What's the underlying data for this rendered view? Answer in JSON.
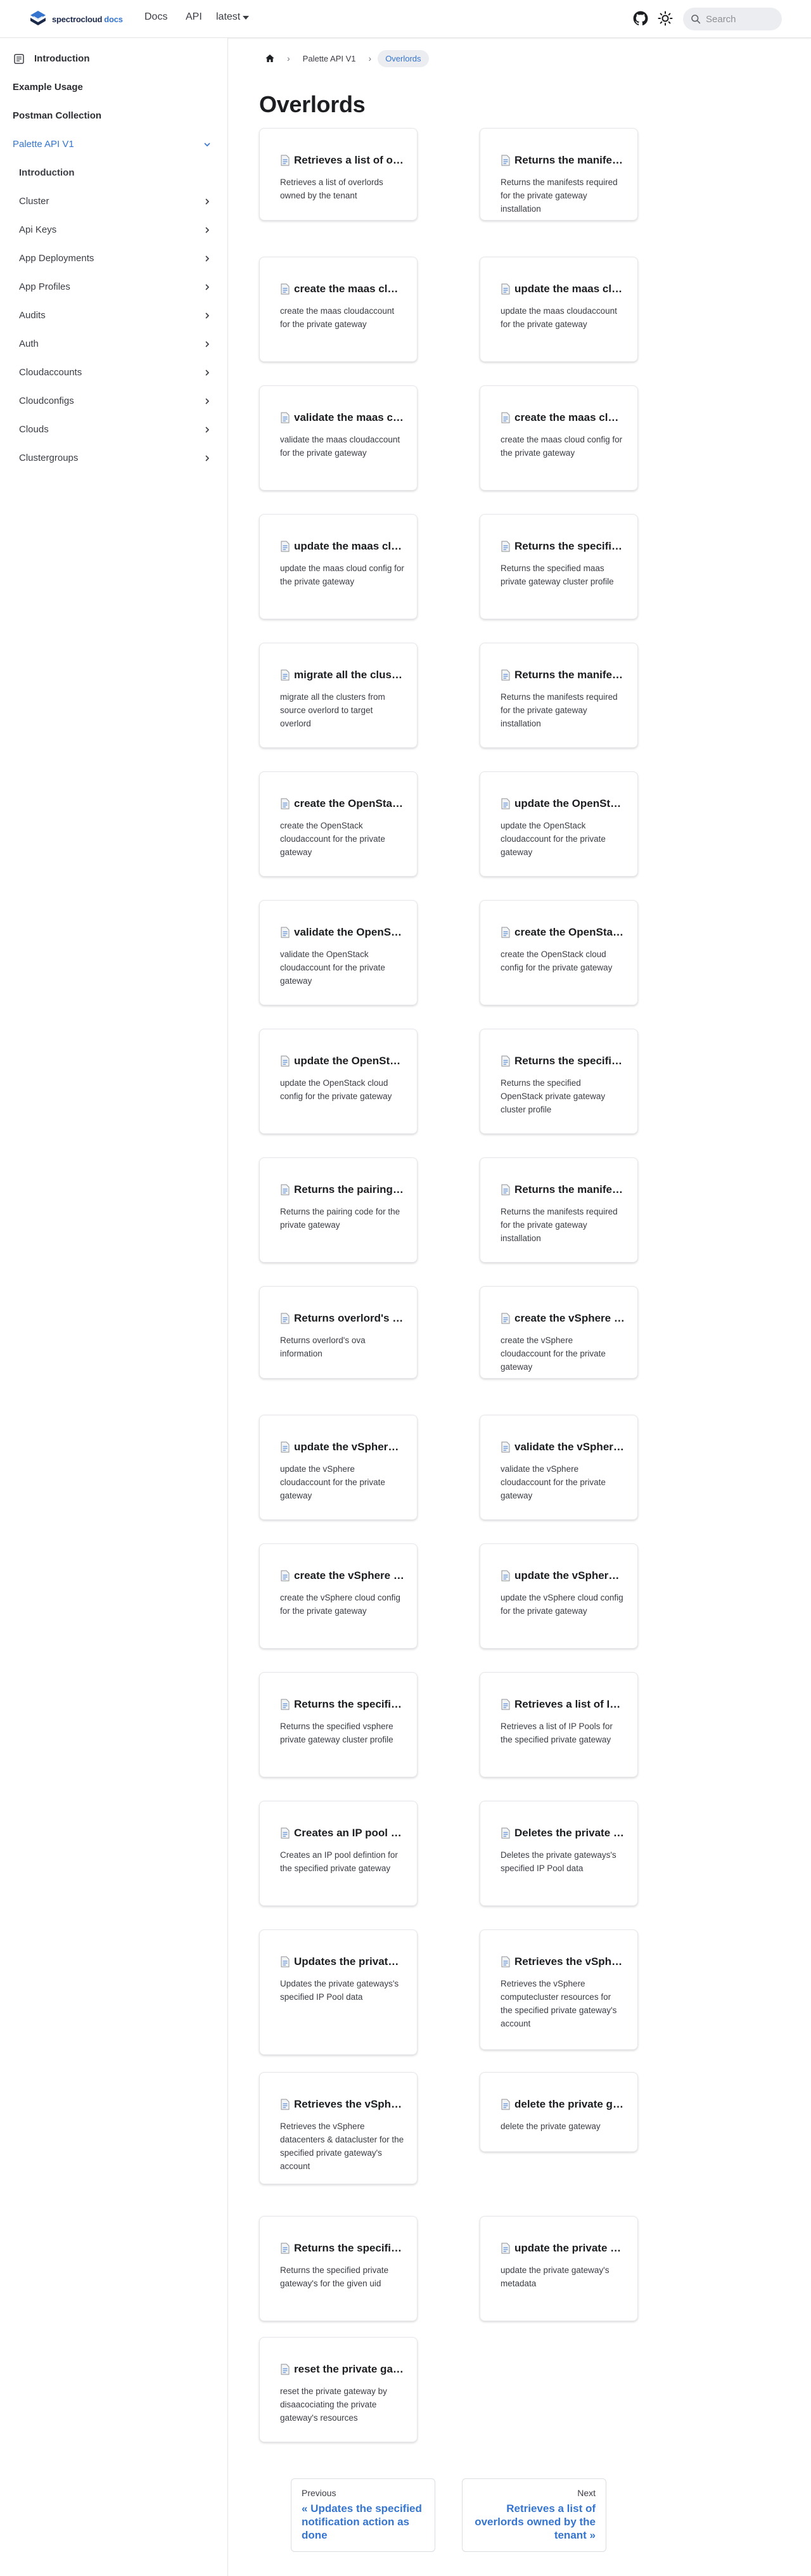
{
  "navbar": {
    "brand_name": "spectrocloud",
    "brand_docs": "docs",
    "links": [
      "Docs",
      "API"
    ],
    "version": "latest",
    "search_placeholder": "Search",
    "icons": [
      "github-icon",
      "theme-toggle-icon",
      "search-icon"
    ]
  },
  "sidebar": {
    "items": [
      {
        "label": "Introduction",
        "kind": "top-icon"
      },
      {
        "label": "Example Usage",
        "kind": "top"
      },
      {
        "label": "Postman Collection",
        "kind": "top"
      },
      {
        "label": "Palette API V1",
        "kind": "category-open"
      },
      {
        "label": "Introduction",
        "kind": "sub-bold"
      },
      {
        "label": "Cluster",
        "kind": "sub-collapsed"
      },
      {
        "label": "Api Keys",
        "kind": "sub-collapsed"
      },
      {
        "label": "App Deployments",
        "kind": "sub-collapsed"
      },
      {
        "label": "App Profiles",
        "kind": "sub-collapsed"
      },
      {
        "label": "Audits",
        "kind": "sub-collapsed"
      },
      {
        "label": "Auth",
        "kind": "sub-collapsed"
      },
      {
        "label": "Cloudaccounts",
        "kind": "sub-collapsed"
      },
      {
        "label": "Cloudconfigs",
        "kind": "sub-collapsed"
      },
      {
        "label": "Clouds",
        "kind": "sub-collapsed"
      },
      {
        "label": "Clustergroups",
        "kind": "sub-collapsed"
      }
    ]
  },
  "breadcrumbs": {
    "items": [
      "Palette API V1"
    ],
    "current": "Overlords"
  },
  "page_title": "Overlords",
  "cards": [
    {
      "title": "Retrieves a list of overlords owned by the tenant",
      "desc": "Retrieves a list of overlords owned by the tenant"
    },
    {
      "title": "Returns the manifests required for the private gateway installation",
      "desc": "Returns the manifests required for the private gateway installation"
    },
    {
      "title": "create the maas cloudaccount for the private gateway",
      "desc": "create the maas cloudaccount for the private gateway"
    },
    {
      "title": "update the maas cloudaccount for the private gateway",
      "desc": "update the maas cloudaccount for the private gateway"
    },
    {
      "title": "validate the maas cloudaccount for the private gateway",
      "desc": "validate the maas cloudaccount for the private gateway"
    },
    {
      "title": "create the maas cloud config for the private gateway",
      "desc": "create the maas cloud config for the private gateway"
    },
    {
      "title": "update the maas cloud config for the private gateway",
      "desc": "update the maas cloud config for the private gateway"
    },
    {
      "title": "Returns the specified maas private gateway cluster profile",
      "desc": "Returns the specified maas private gateway cluster profile"
    },
    {
      "title": "migrate all the clusters from source overlord to target overlord",
      "desc": "migrate all the clusters from source overlord to target overlord"
    },
    {
      "title": "Returns the manifests required for the private gateway installation",
      "desc": "Returns the manifests required for the private gateway installation"
    },
    {
      "title": "create the OpenStack cloudaccount for the private gateway",
      "desc": "create the OpenStack cloudaccount for the private gateway"
    },
    {
      "title": "update the OpenStack cloudaccount for the private gateway",
      "desc": "update the OpenStack cloudaccount for the private gateway"
    },
    {
      "title": "validate the OpenStack cloudaccount for the private gateway",
      "desc": "validate the OpenStack cloudaccount for the private gateway"
    },
    {
      "title": "create the OpenStack cloud config for the private gateway",
      "desc": "create the OpenStack cloud config for the private gateway"
    },
    {
      "title": "update the OpenStack cloud config for the private gateway",
      "desc": "update the OpenStack cloud config for the private gateway"
    },
    {
      "title": "Returns the specified OpenStack private gateway cluster profile",
      "desc": "Returns the specified OpenStack private gateway cluster profile"
    },
    {
      "title": "Returns the pairing code for the private gateway",
      "desc": "Returns the pairing code for the private gateway"
    },
    {
      "title": "Returns the manifests required for the private gateway installation",
      "desc": "Returns the manifests required for the private gateway installation"
    },
    {
      "title": "Returns overlord's ova information",
      "desc": "Returns overlord's ova information"
    },
    {
      "title": "create the vSphere cloudaccount for the private gateway",
      "desc": "create the vSphere cloudaccount for the private gateway"
    },
    {
      "title": "update the vSphere cloudaccount for the private gateway",
      "desc": "update the vSphere cloudaccount for the private gateway"
    },
    {
      "title": "validate the vSphere cloudaccount for the private gateway",
      "desc": "validate the vSphere cloudaccount for the private gateway"
    },
    {
      "title": "create the vSphere cloud config for the private gateway",
      "desc": "create the vSphere cloud config for the private gateway"
    },
    {
      "title": "update the vSphere cloud config for the private gateway",
      "desc": "update the vSphere cloud config for the private gateway"
    },
    {
      "title": "Returns the specified vsphere private gateway cluster profile",
      "desc": "Returns the specified vsphere private gateway cluster profile"
    },
    {
      "title": "Retrieves a list of IP Pools for the specified private gateway",
      "desc": "Retrieves a list of IP Pools for the specified private gateway"
    },
    {
      "title": "Creates an IP pool defintion for the specified private gateway",
      "desc": "Creates an IP pool defintion for the specified private gateway"
    },
    {
      "title": "Deletes the private gateways's specified IP Pool data",
      "desc": "Deletes the private gateways's specified IP Pool data"
    },
    {
      "title": "Updates the private gateways's specified IP Pool data",
      "desc": "Updates the private gateways's specified IP Pool data"
    },
    {
      "title": "Retrieves the vSphere computecluster resources for the specified private gateway's account",
      "desc": "Retrieves the vSphere computecluster resources for the specified private gateway's account"
    },
    {
      "title": "Retrieves the vSphere datacenters & datacluster for the specified private gateway's account",
      "desc": "Retrieves the vSphere datacenters & datacluster for the specified private gateway's account"
    },
    {
      "title": "delete the private gateway",
      "desc": "delete the private gateway"
    },
    {
      "title": "Returns the specified private gateway's for the given uid",
      "desc": "Returns the specified private gateway's for the given uid"
    },
    {
      "title": "update the private gateway's metadata",
      "desc": "update the private gateway's metadata"
    },
    {
      "title": "reset the private gateway by disaacociating the private gateway's resources",
      "desc": "reset the private gateway by disaacociating the private gateway's resources"
    }
  ],
  "pagination": {
    "prev_label": "Previous",
    "prev_title": "« Updates the specified notification action as done",
    "next_label": "Next",
    "next_title": "Retrieves a list of overlords owned by the tenant »"
  },
  "colors": {
    "accent": "#3575cf",
    "text": "#1c1e21",
    "muted": "#3b3d45",
    "border": "#e3e3e3"
  }
}
